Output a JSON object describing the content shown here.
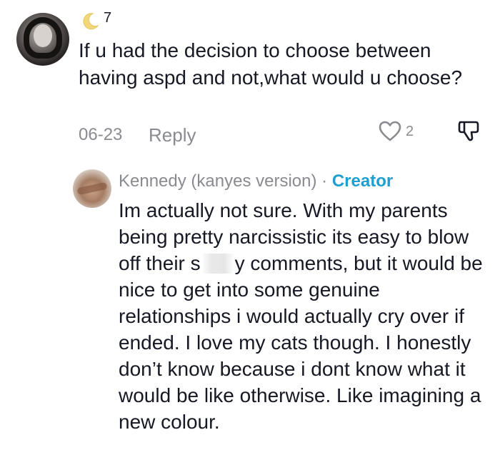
{
  "comment": {
    "badge_count": "7",
    "text": "If u had the decision to choose between having aspd and not,what would u choose?",
    "date": "06-23",
    "reply_label": "Reply",
    "like_count": "2"
  },
  "reply": {
    "author": "Kennedy (kanyes version)",
    "separator": "·",
    "role_badge": "Creator",
    "text_part1": "Im actually not sure. With my parents being pretty narcissistic its easy to blow off their s",
    "text_part2": "y comments, but it would be nice to get into some genuine relationships i would actually cry over if ended. I love my cats though. I honestly don’t know because i dont know what it would be like otherwise. Like imagining a new colour."
  },
  "colors": {
    "text": "#161823",
    "muted": "#8a8b91",
    "creator_accent": "#1f9fd0"
  },
  "icons": [
    "crescent-moon-icon",
    "heart-icon",
    "dislike-icon"
  ]
}
